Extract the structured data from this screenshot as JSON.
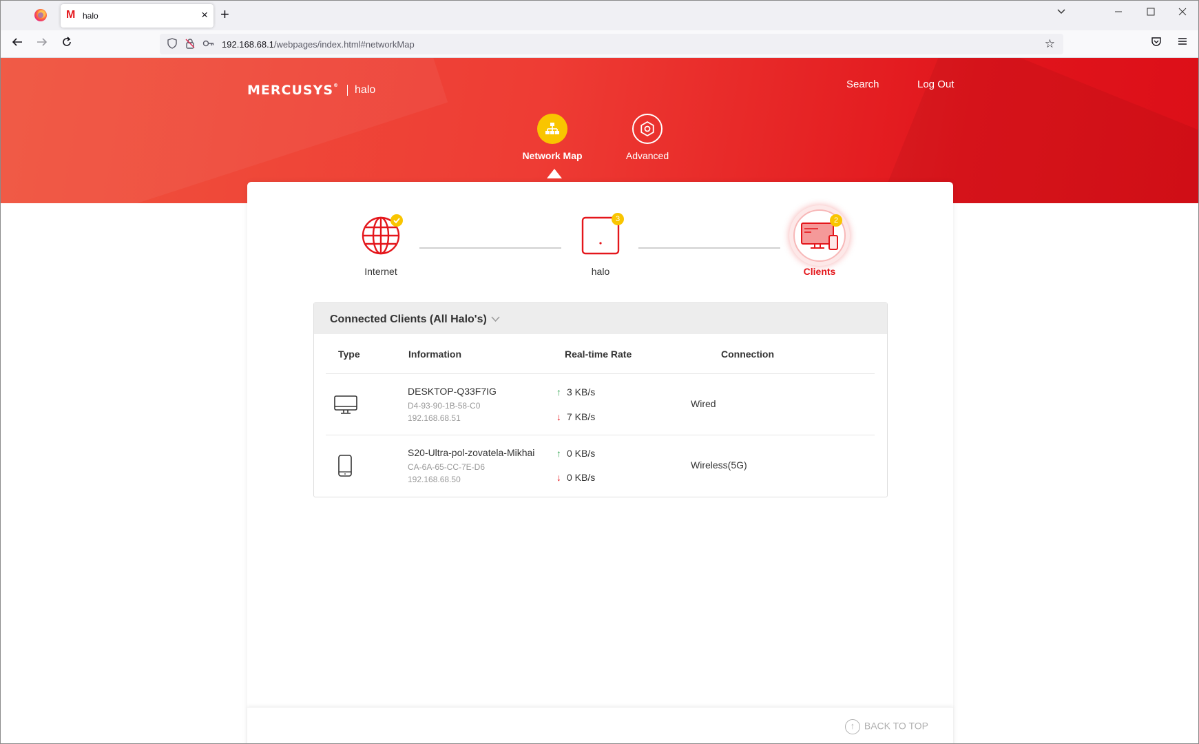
{
  "browser": {
    "tab_title": "halo",
    "tab_favicon": "M",
    "url_host": "192.168.68.1",
    "url_path": "/webpages/index.html#networkMap"
  },
  "header": {
    "brand": "MERCUSYS",
    "router_name": "halo",
    "search_label": "Search",
    "logout_label": "Log Out"
  },
  "menu": {
    "network_map": "Network Map",
    "advanced": "Advanced"
  },
  "topology": {
    "internet_label": "Internet",
    "halo_label": "halo",
    "halo_count": "3",
    "clients_label": "Clients",
    "clients_count": "2"
  },
  "clients": {
    "title": "Connected Clients (All Halo's)",
    "columns": {
      "type": "Type",
      "information": "Information",
      "rate": "Real-time Rate",
      "connection": "Connection"
    },
    "rows": [
      {
        "icon": "desktop-icon",
        "name": "DESKTOP-Q33F7IG",
        "mac": "D4-93-90-1B-58-C0",
        "ip": "192.168.68.51",
        "up": "3 KB/s",
        "down": "7 KB/s",
        "connection": "Wired"
      },
      {
        "icon": "phone-icon",
        "name": "S20-Ultra-pol-zovatela-Mikhai",
        "mac": "CA-6A-65-CC-7E-D6",
        "ip": "192.168.68.50",
        "up": "0 KB/s",
        "down": "0 KB/s",
        "connection": "Wireless(5G)"
      }
    ]
  },
  "footer": {
    "back_to_top": "BACK TO TOP"
  },
  "colors": {
    "brand_red": "#e4161b",
    "accent_yellow": "#f9c500",
    "up_green": "#2ba24c"
  }
}
